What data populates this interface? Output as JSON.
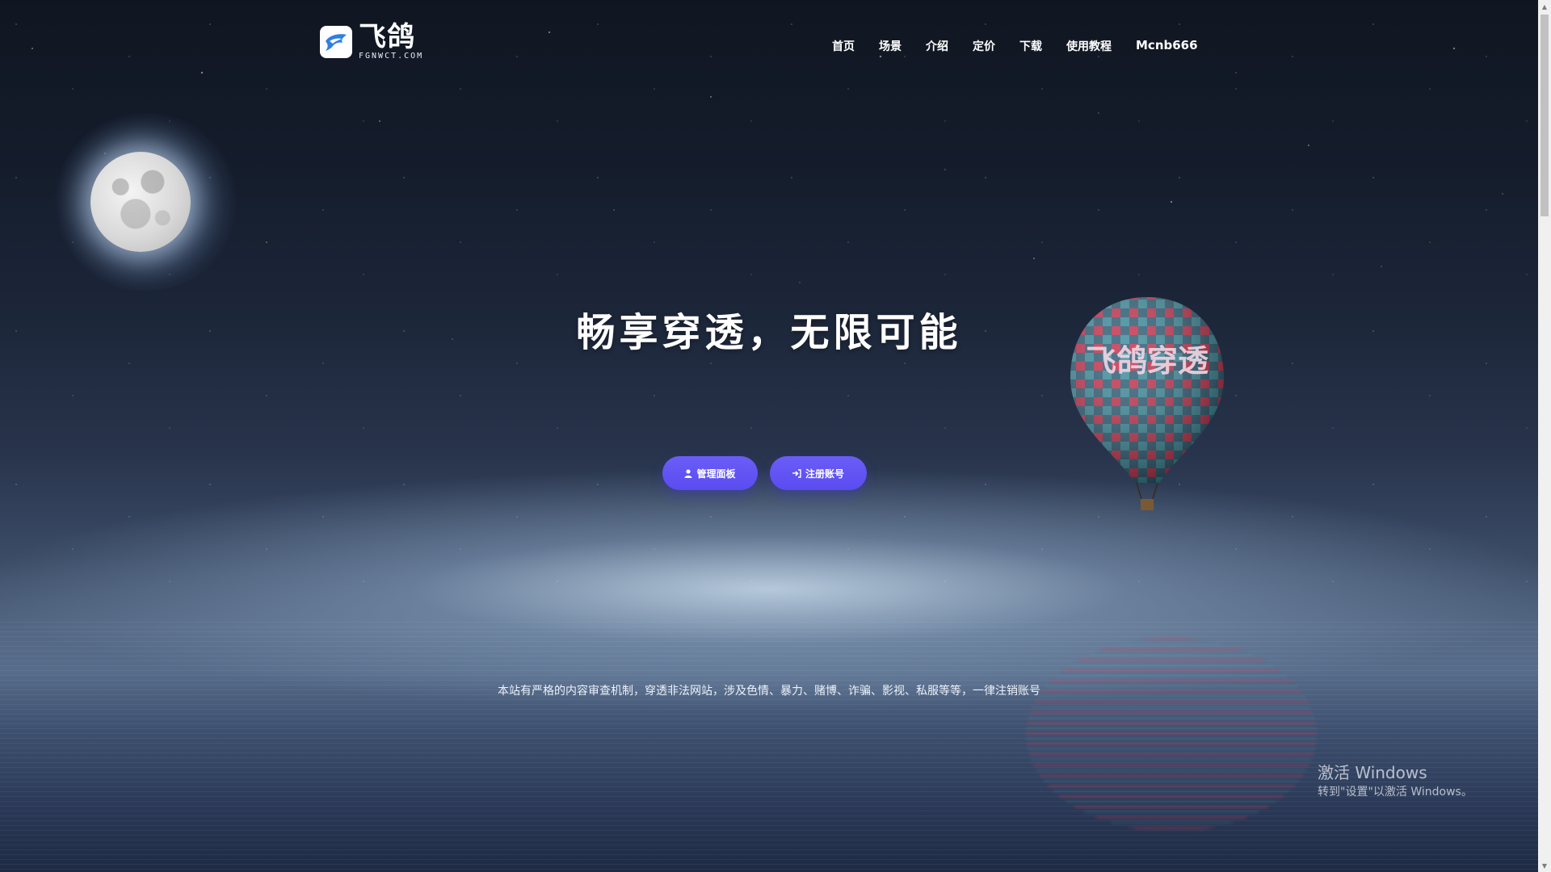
{
  "brand": {
    "logo_text": "飞鸽",
    "logo_subtext": "FGNWCT.COM"
  },
  "nav": {
    "items": [
      {
        "label": "首页"
      },
      {
        "label": "场景"
      },
      {
        "label": "介绍"
      },
      {
        "label": "定价"
      },
      {
        "label": "下载"
      },
      {
        "label": "使用教程"
      }
    ],
    "user": "Mcnb666"
  },
  "hero": {
    "title": "畅享穿透，无限可能",
    "buttons": {
      "admin": {
        "label": "管理面板",
        "icon": "user-icon"
      },
      "register": {
        "label": "注册账号",
        "icon": "sign-in-icon"
      }
    },
    "balloon_text": "飞鸽穿透"
  },
  "notice": "本站有严格的内容审查机制，穿透非法网站，涉及色情、暴力、赌博、诈骗、影视、私服等等，一律注销账号",
  "watermark": {
    "line1": "激活 Windows",
    "line2": "转到\"设置\"以激活 Windows。"
  },
  "colors": {
    "button_bg": "#5a4cf0",
    "text": "#ffffff"
  }
}
